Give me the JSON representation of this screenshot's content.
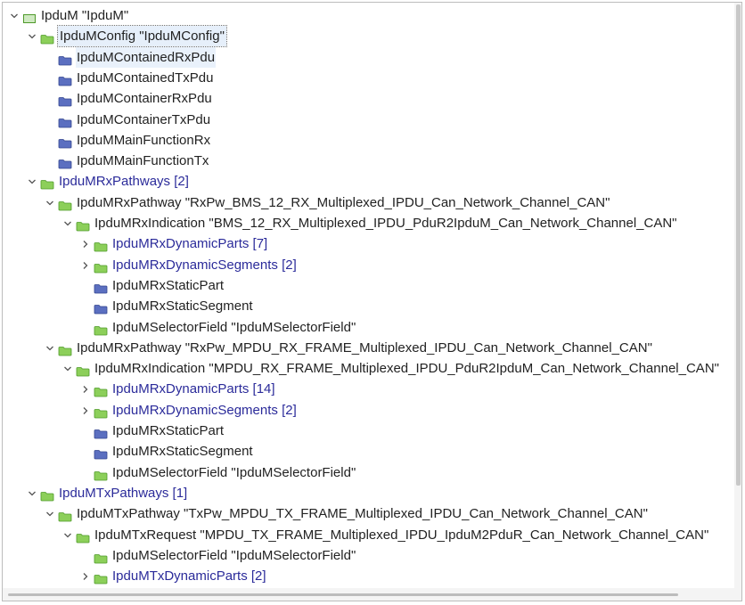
{
  "tree": {
    "nodes": [
      {
        "label": "IpduM \"IpduM\"",
        "level": 0,
        "toggle": "expanded",
        "folder": "module",
        "style": "normal"
      },
      {
        "label": "IpduMConfig \"IpduMConfig\"",
        "level": 1,
        "toggle": "expanded",
        "folder": "green",
        "style": "selected"
      },
      {
        "label": "IpduMContainedRxPdu",
        "level": 2,
        "toggle": "none",
        "folder": "blue",
        "style": "highlight"
      },
      {
        "label": "IpduMContainedTxPdu",
        "level": 2,
        "toggle": "none",
        "folder": "blue",
        "style": "normal"
      },
      {
        "label": "IpduMContainerRxPdu",
        "level": 2,
        "toggle": "none",
        "folder": "blue",
        "style": "normal"
      },
      {
        "label": "IpduMContainerTxPdu",
        "level": 2,
        "toggle": "none",
        "folder": "blue",
        "style": "normal"
      },
      {
        "label": "IpduMMainFunctionRx",
        "level": 2,
        "toggle": "none",
        "folder": "blue",
        "style": "normal"
      },
      {
        "label": "IpduMMainFunctionTx",
        "level": 2,
        "toggle": "none",
        "folder": "blue",
        "style": "normal"
      },
      {
        "label": "IpduMRxPathways [2]",
        "level": 1,
        "toggle": "expanded",
        "folder": "green",
        "style": "link"
      },
      {
        "label": "IpduMRxPathway \"RxPw_BMS_12_RX_Multiplexed_IPDU_Can_Network_Channel_CAN\"",
        "level": 2,
        "toggle": "expanded",
        "folder": "green",
        "style": "normal"
      },
      {
        "label": "IpduMRxIndication \"BMS_12_RX_Multiplexed_IPDU_PduR2IpduM_Can_Network_Channel_CAN\"",
        "level": 3,
        "toggle": "expanded",
        "folder": "green",
        "style": "normal"
      },
      {
        "label": "IpduMRxDynamicParts [7]",
        "level": 4,
        "toggle": "collapsed",
        "folder": "green",
        "style": "link"
      },
      {
        "label": "IpduMRxDynamicSegments [2]",
        "level": 4,
        "toggle": "collapsed",
        "folder": "green",
        "style": "link"
      },
      {
        "label": "IpduMRxStaticPart",
        "level": 4,
        "toggle": "none",
        "folder": "blue",
        "style": "normal"
      },
      {
        "label": "IpduMRxStaticSegment",
        "level": 4,
        "toggle": "none",
        "folder": "blue",
        "style": "normal"
      },
      {
        "label": "IpduMSelectorField \"IpduMSelectorField\"",
        "level": 4,
        "toggle": "none",
        "folder": "green",
        "style": "normal"
      },
      {
        "label": "IpduMRxPathway \"RxPw_MPDU_RX_FRAME_Multiplexed_IPDU_Can_Network_Channel_CAN\"",
        "level": 2,
        "toggle": "expanded",
        "folder": "green",
        "style": "normal"
      },
      {
        "label": "IpduMRxIndication \"MPDU_RX_FRAME_Multiplexed_IPDU_PduR2IpduM_Can_Network_Channel_CAN\"",
        "level": 3,
        "toggle": "expanded",
        "folder": "green",
        "style": "normal"
      },
      {
        "label": "IpduMRxDynamicParts [14]",
        "level": 4,
        "toggle": "collapsed",
        "folder": "green",
        "style": "link"
      },
      {
        "label": "IpduMRxDynamicSegments [2]",
        "level": 4,
        "toggle": "collapsed",
        "folder": "green",
        "style": "link"
      },
      {
        "label": "IpduMRxStaticPart",
        "level": 4,
        "toggle": "none",
        "folder": "blue",
        "style": "normal"
      },
      {
        "label": "IpduMRxStaticSegment",
        "level": 4,
        "toggle": "none",
        "folder": "blue",
        "style": "normal"
      },
      {
        "label": "IpduMSelectorField \"IpduMSelectorField\"",
        "level": 4,
        "toggle": "none",
        "folder": "green",
        "style": "normal"
      },
      {
        "label": "IpduMTxPathways [1]",
        "level": 1,
        "toggle": "expanded",
        "folder": "green",
        "style": "link"
      },
      {
        "label": "IpduMTxPathway \"TxPw_MPDU_TX_FRAME_Multiplexed_IPDU_Can_Network_Channel_CAN\"",
        "level": 2,
        "toggle": "expanded",
        "folder": "green",
        "style": "normal"
      },
      {
        "label": "IpduMTxRequest \"MPDU_TX_FRAME_Multiplexed_IPDU_IpduM2PduR_Can_Network_Channel_CAN\"",
        "level": 3,
        "toggle": "expanded",
        "folder": "green",
        "style": "normal"
      },
      {
        "label": "IpduMSelectorField \"IpduMSelectorField\"",
        "level": 4,
        "toggle": "none",
        "folder": "green",
        "style": "normal"
      },
      {
        "label": "IpduMTxDynamicParts [2]",
        "level": 4,
        "toggle": "collapsed",
        "folder": "green",
        "style": "link"
      }
    ]
  },
  "colors": {
    "green_folder": "#8ccf5a",
    "green_folder_dark": "#4f9a2a",
    "blue_folder": "#5b6fc0",
    "blue_folder_dark": "#34468f",
    "module_icon": "#cfe9c2",
    "link_text": "#2b2b9a"
  }
}
